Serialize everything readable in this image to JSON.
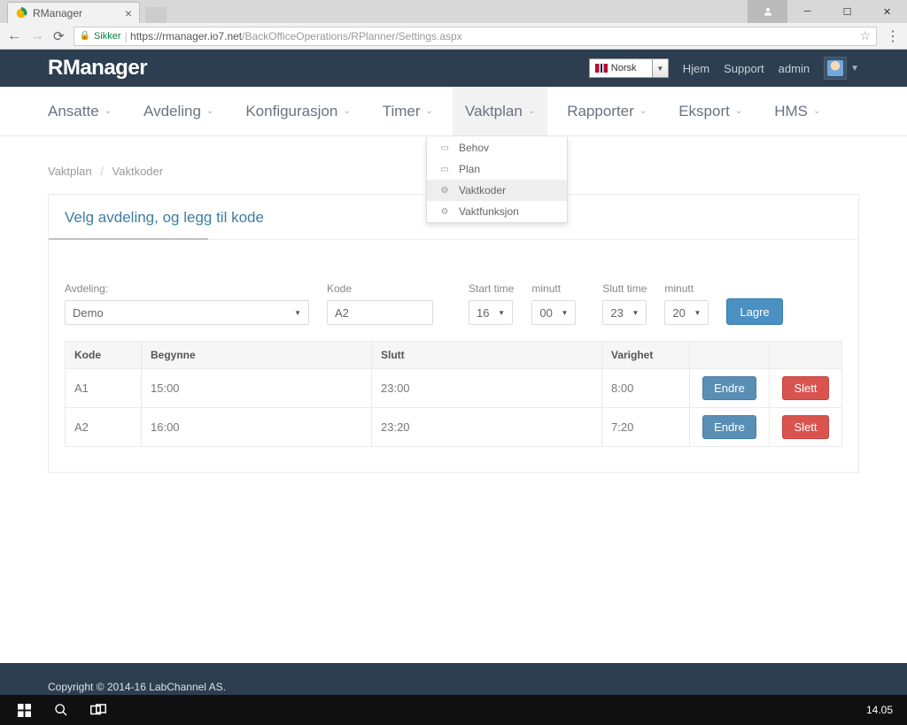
{
  "browser": {
    "tab_title": "RManager",
    "secure_label": "Sikker",
    "url_host": "https://rmanager.io7.net",
    "url_path": "/BackOfficeOperations/RPlanner/Settings.aspx"
  },
  "header": {
    "brand": "RManager",
    "language": "Norsk",
    "links": {
      "home": "Hjem",
      "support": "Support",
      "admin": "admin"
    }
  },
  "nav": {
    "items": [
      "Ansatte",
      "Avdeling",
      "Konfigurasjon",
      "Timer",
      "Vaktplan",
      "Rapporter",
      "Eksport",
      "HMS"
    ]
  },
  "dropdown": {
    "items": [
      {
        "label": "Behov",
        "icon": "▭"
      },
      {
        "label": "Plan",
        "icon": "▭"
      },
      {
        "label": "Vaktkoder",
        "icon": "⚙",
        "hover": true
      },
      {
        "label": "Vaktfunksjon",
        "icon": "⚙"
      }
    ]
  },
  "breadcrumb": {
    "a": "Vaktplan",
    "b": "Vaktkoder"
  },
  "panel": {
    "title": "Velg avdeling, og legg til kode",
    "labels": {
      "avdeling": "Avdeling:",
      "kode": "Kode",
      "start_time": "Start time",
      "minutt1": "minutt",
      "slutt_time": "Slutt time",
      "minutt2": "minutt",
      "lagre": "Lagre"
    },
    "values": {
      "avdeling": "Demo",
      "kode": "A2",
      "start_h": "16",
      "start_m": "00",
      "slutt_h": "23",
      "slutt_m": "20"
    }
  },
  "table": {
    "headers": {
      "kode": "Kode",
      "begynne": "Begynne",
      "slutt": "Slutt",
      "varighet": "Varighet"
    },
    "buttons": {
      "edit": "Endre",
      "delete": "Slett"
    },
    "rows": [
      {
        "kode": "A1",
        "begynne": "15:00",
        "slutt": "23:00",
        "varighet": "8:00"
      },
      {
        "kode": "A2",
        "begynne": "16:00",
        "slutt": "23:20",
        "varighet": "7:20"
      }
    ]
  },
  "footer": {
    "copyright": "Copyright © 2014-16 LabChannel AS."
  },
  "taskbar": {
    "clock": "14.05"
  }
}
